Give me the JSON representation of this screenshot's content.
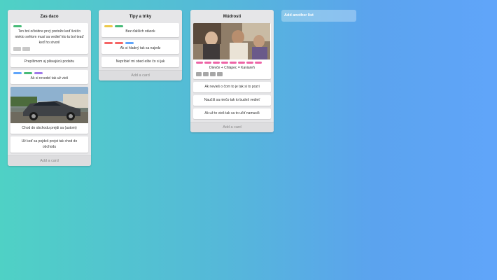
{
  "lists": [
    {
      "title": "Zas daco",
      "add_card": "Add a card",
      "cards": [
        {
          "text": "Ten bol očividne prvý pretože keď švéčo niekto světom musí sa vedieť kto tu bol teaď keď ho stvoril",
          "labels": [
            "#48bb78"
          ],
          "badges": 2
        },
        {
          "text": "Prepíšmom aj plávajúcú podahu"
        },
        {
          "text": "Ak si revedel tak už vieš",
          "labels": [
            "#60a5fa",
            "#48bb78",
            "#9f7aea"
          ]
        },
        {
          "text": "Chod do obchodu prejdi sa (autom)",
          "image": "car-photo"
        },
        {
          "text": "Už keď sa pojdeš prejst tak chod do obchodu"
        }
      ]
    },
    {
      "title": "Tipy a triky",
      "add_card": "Add a card",
      "cards": [
        {
          "text": "Bez ďalších otázok",
          "labels": [
            "#ecc94b",
            "#48bb78"
          ]
        },
        {
          "text": "Ak si hladný tak sa najedz",
          "labels": [
            "#f56565",
            "#f56565",
            "#60a5fa"
          ]
        },
        {
          "text": "Nepríbie! mi obed ešte čo si jak"
        }
      ]
    },
    {
      "title": "Múdrosti",
      "add_card": "Add a card",
      "cards": [
        {
          "text": "Dievče + Chlapec = Kaviareň",
          "image": "people-photo",
          "labels": [
            "#ed64a6",
            "#ed64a6",
            "#ed64a6",
            "#ed64a6",
            "#ed64a6",
            "#ed64a6",
            "#ed64a6",
            "#ed64a6"
          ],
          "badges": 4
        },
        {
          "text": "Ak nevieš o čom to je tak si to pozri"
        },
        {
          "text": "Naučíš sa niečo tak to budeš vedieť"
        },
        {
          "text": "Ak už to vieš tak sa to učiť namusíš"
        }
      ]
    }
  ],
  "add_list": "Add another list"
}
